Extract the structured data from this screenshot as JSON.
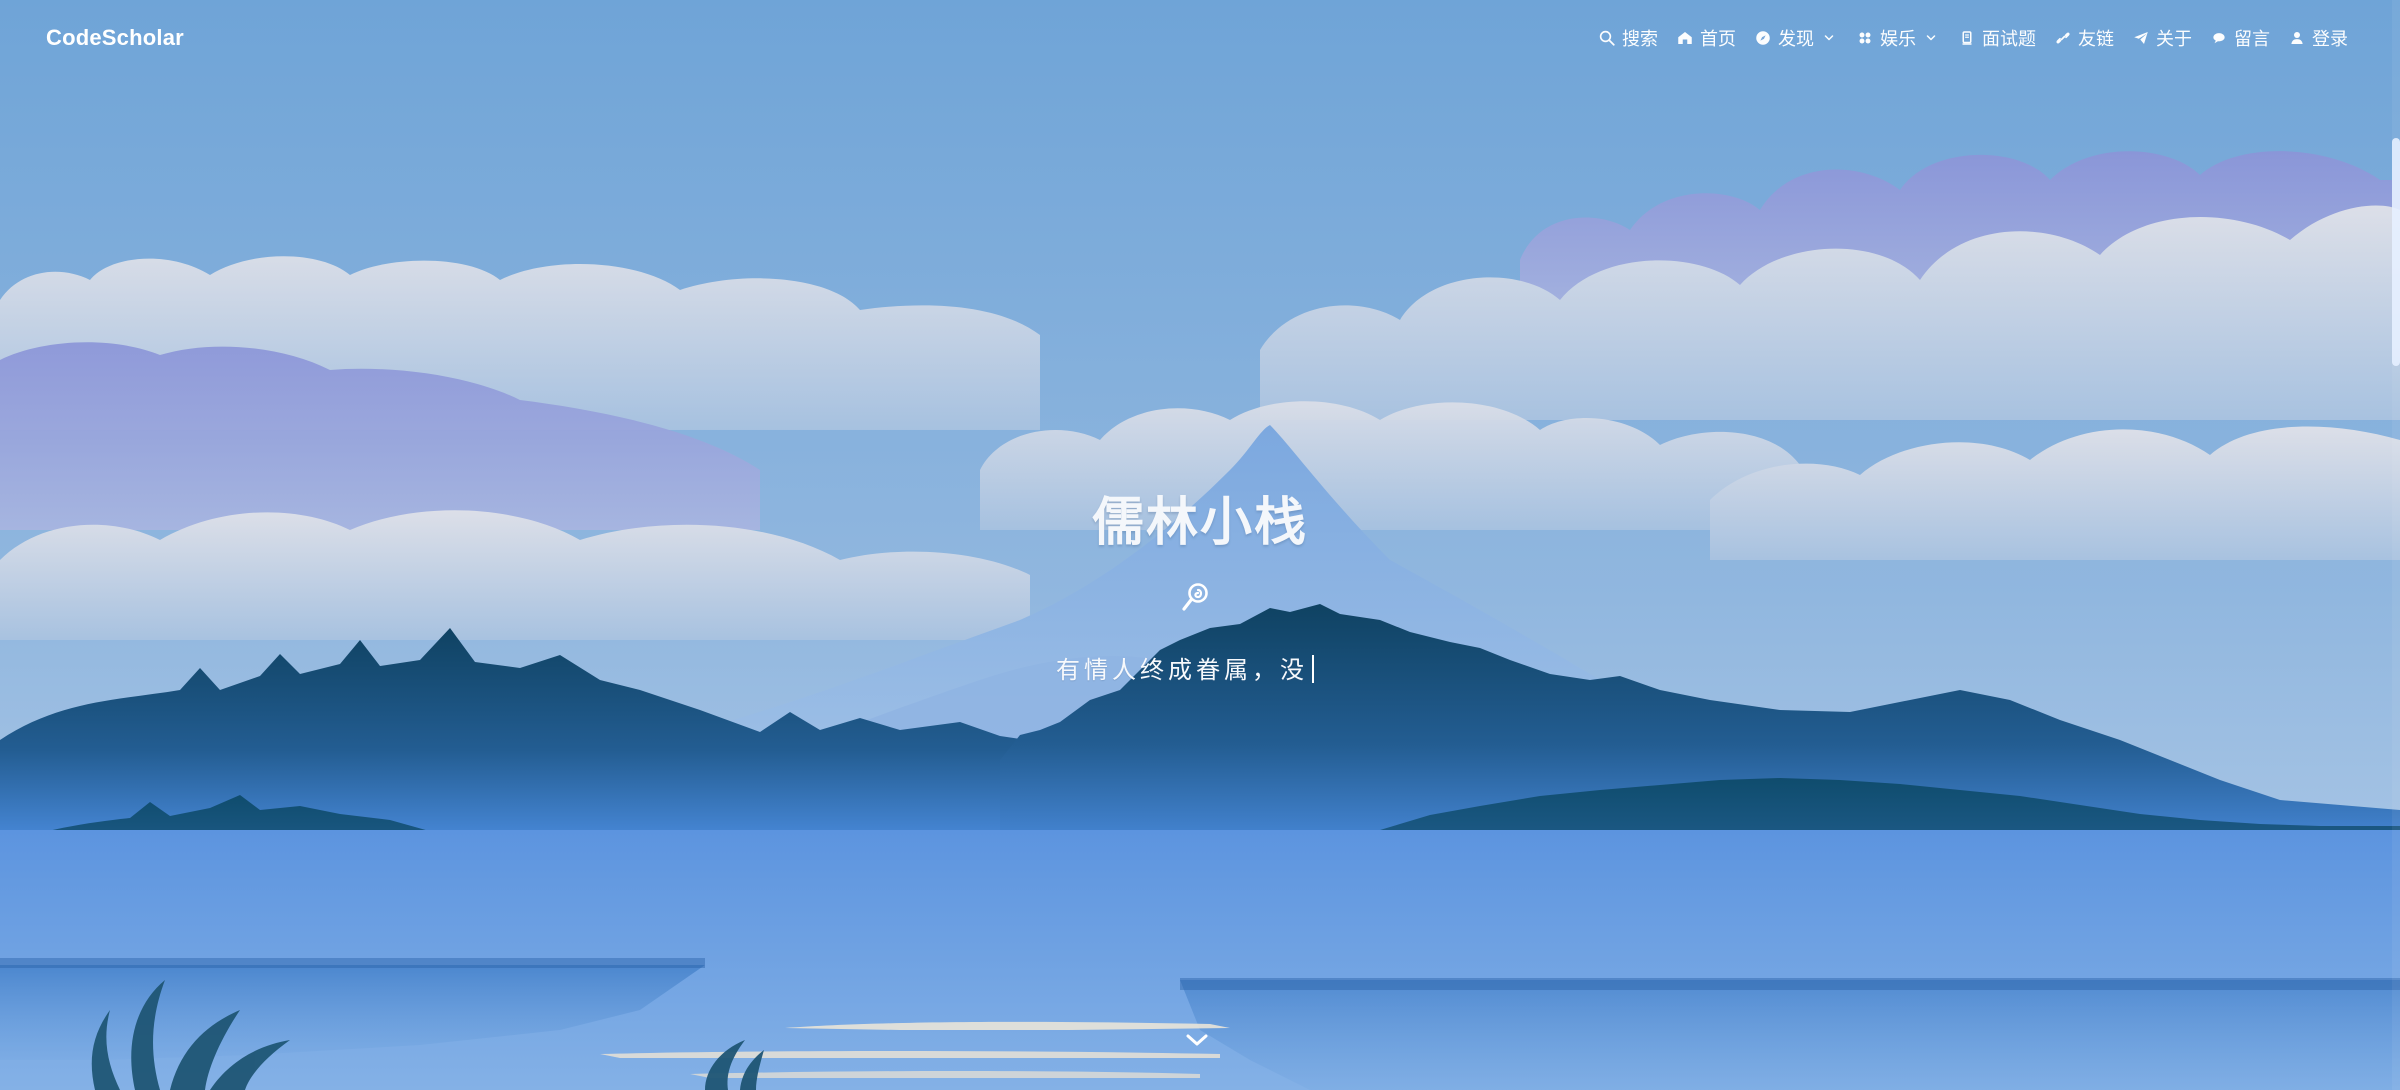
{
  "header": {
    "brand": "CodeScholar"
  },
  "nav": {
    "items": [
      {
        "label": "搜索",
        "icon": "search-icon"
      },
      {
        "label": "首页",
        "icon": "home-icon"
      },
      {
        "label": "发现",
        "icon": "compass-icon",
        "dropdown": true
      },
      {
        "label": "娱乐",
        "icon": "grid-icon",
        "dropdown": true
      },
      {
        "label": "面试题",
        "icon": "book-icon"
      },
      {
        "label": "友链",
        "icon": "link-icon"
      },
      {
        "label": "关于",
        "icon": "send-icon"
      },
      {
        "label": "留言",
        "icon": "chat-icon"
      },
      {
        "label": "登录",
        "icon": "user-icon"
      }
    ]
  },
  "hero": {
    "title": "儒林小栈",
    "subtitle": "有情人终成眷属，没",
    "icon": "lollipop-icon"
  },
  "colors": {
    "sky_top": "#6fa4d7",
    "sky_bottom": "#b9d0ea",
    "cloud_light": "#dcdfe8",
    "cloud_purple": "#8e97d8",
    "forest_dark": "#0f4a6e",
    "water": "#78a9df",
    "white": "#ffffff"
  }
}
